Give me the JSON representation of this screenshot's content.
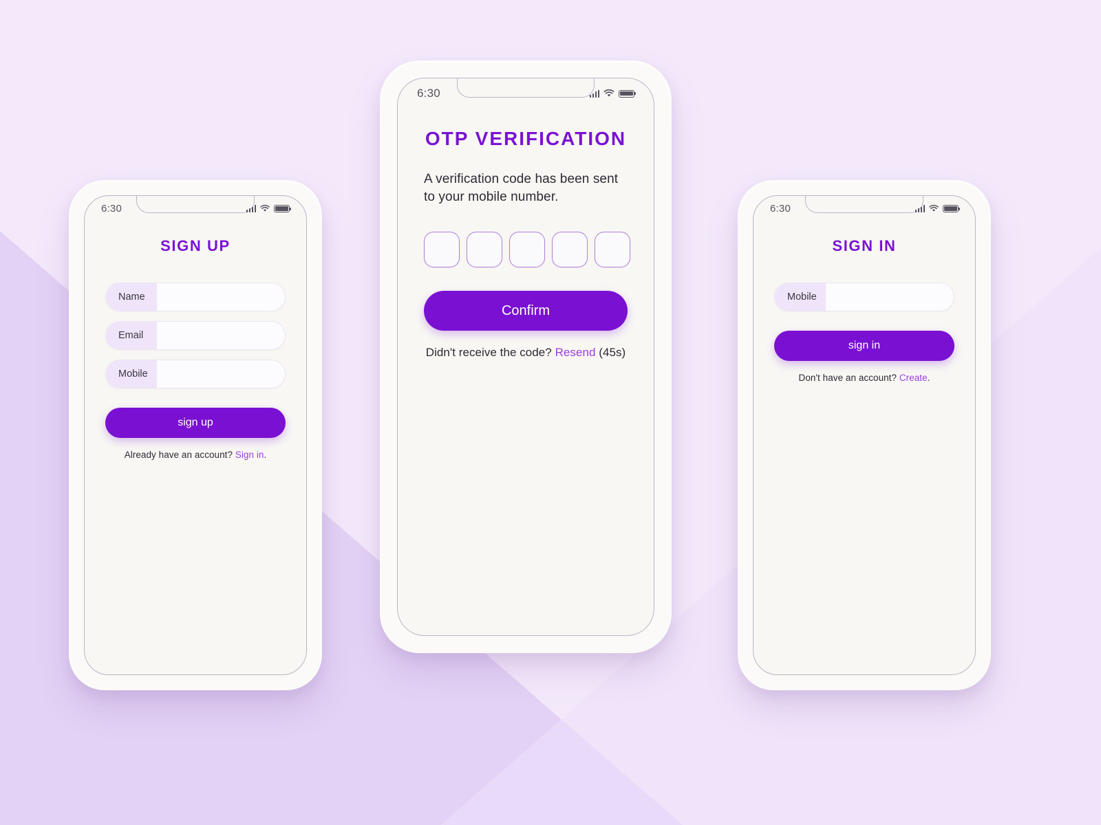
{
  "theme": {
    "background_light": "#f4e9fb",
    "background_deep": "#e3d2f5",
    "accent_purple": "#7a10d2",
    "title_purple": "#7a12d4",
    "link_purple": "#9b3ee0",
    "phone_body": "#fbfaf8",
    "screen_bg": "#f8f7f4",
    "field_label_bg": "#f0e4fa",
    "otp_border": "#b07fd8"
  },
  "status_bar": {
    "time": "6:30",
    "icons": [
      "signal-icon",
      "wifi-icon",
      "battery-icon"
    ]
  },
  "screens": [
    {
      "id": "sign-up",
      "title": "SIGN UP",
      "fields": [
        {
          "label": "Name",
          "value": "",
          "placeholder": ""
        },
        {
          "label": "Email",
          "value": "",
          "placeholder": ""
        },
        {
          "label": "Mobile",
          "value": "",
          "placeholder": ""
        }
      ],
      "submit_label": "sign up",
      "footer": {
        "text": "Already have an account? ",
        "link": "Sign in",
        "suffix": "."
      }
    },
    {
      "id": "otp-verification",
      "title": "OTP VERIFICATION",
      "subtitle": "A verification code has been sent to your mobile number.",
      "otp": {
        "count": 5,
        "values": [
          "",
          "",
          "",
          "",
          ""
        ]
      },
      "submit_label": "Confirm",
      "footer": {
        "text": "Didn't receive the code? ",
        "link": "Resend",
        "suffix": " (45s)"
      }
    },
    {
      "id": "sign-in",
      "title": "SIGN IN",
      "fields": [
        {
          "label": "Mobile",
          "value": "",
          "placeholder": ""
        }
      ],
      "submit_label": "sign in",
      "footer": {
        "text": "Don't have an account? ",
        "link": "Create",
        "suffix": "."
      }
    }
  ]
}
